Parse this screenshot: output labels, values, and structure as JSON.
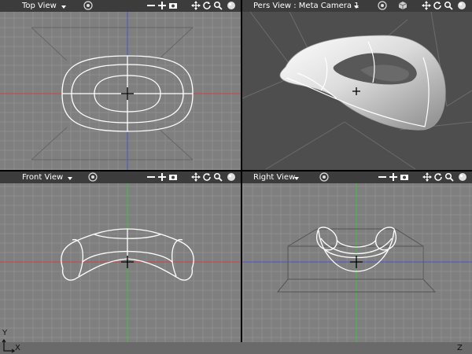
{
  "viewports": {
    "top": {
      "title": "Top View",
      "button_icons": [
        "target-icon",
        "move-icon",
        "zoom-icon",
        "camera-icon",
        "pan-icon",
        "rotate-icon",
        "search-icon",
        "sphere-icon"
      ]
    },
    "pers": {
      "title": "Pers View : Meta Camera 1",
      "button_icons": [
        "target-icon",
        "cube-icon",
        "pan-icon",
        "rotate-icon",
        "search-icon",
        "sphere-icon"
      ]
    },
    "front": {
      "title": "Front View",
      "button_icons": [
        "target-icon",
        "move-icon",
        "zoom-icon",
        "camera-icon",
        "pan-icon",
        "rotate-icon",
        "search-icon",
        "sphere-icon"
      ]
    },
    "right": {
      "title": "Right View",
      "button_icons": [
        "target-icon",
        "move-icon",
        "zoom-icon",
        "camera-icon",
        "pan-icon",
        "rotate-icon",
        "search-icon",
        "sphere-icon"
      ]
    }
  },
  "axes": {
    "x_label": "X",
    "y_label": "Y",
    "z_label": "Z"
  },
  "colors": {
    "viewport_bg": "#7f7f7f",
    "grid": "#8e8e8e",
    "header_bg": "#3c3c3c",
    "x_axis": "#d04040",
    "y_axis": "#3ec03e",
    "z_axis": "#4a55d0",
    "wire": "#ffffff",
    "divider": "#000000"
  }
}
